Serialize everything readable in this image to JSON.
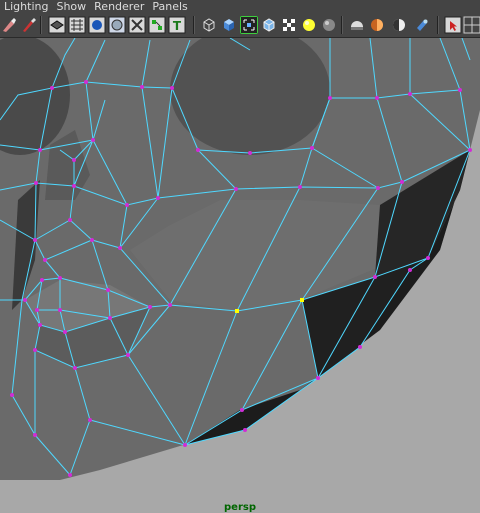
{
  "menu": [
    "Lighting",
    "Show",
    "Renderer",
    "Panels"
  ],
  "toolbar": {
    "buttons": [
      "paint-select-icon",
      "brush-icon",
      "wireframe-shaded-icon",
      "grid-icon",
      "smooth-shade-icon",
      "flat-shade-icon",
      "checker-shade-icon",
      "node-icon",
      "texture-text-icon",
      "isolate-cube-icon",
      "shaded-cube-icon",
      "xray-select-icon",
      "wire-cube-icon",
      "checker-icon",
      "light-icon",
      "sphere-icon",
      "capsule-icon",
      "half-shade-icon",
      "cylinder-icon",
      "select-camera-icon"
    ],
    "selected_button": "xray-select-icon"
  },
  "viewport": {
    "camera": "persp",
    "background_color": "#a8a8a8",
    "mesh_color": "#6a6a6a",
    "wire_color": "#4fd8ff",
    "vertex_color": "#d12cd6",
    "selected_vertex_color": "#ffff00"
  }
}
